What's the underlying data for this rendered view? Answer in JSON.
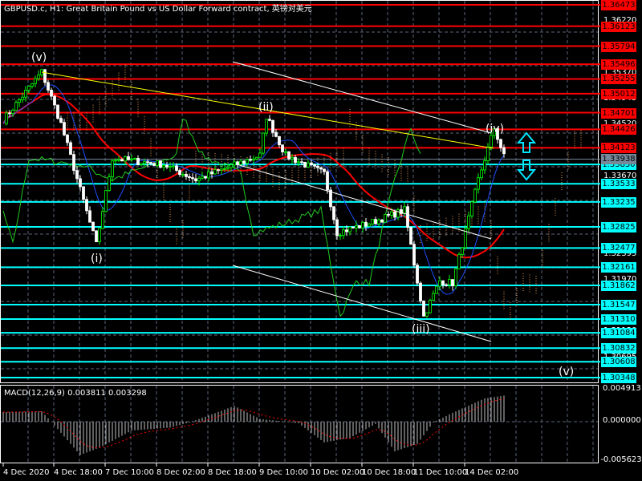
{
  "header": {
    "title": "GBPUSD.c, H1:  Great Britain Pound vs US Dollar Forward contract, 英镑对美元"
  },
  "macd": {
    "title": "MACD(12,26,9) 0.003811 0.003298",
    "max_label": "0.004913",
    "zero_label": "0.000000",
    "min_label": "-0.005623",
    "max": 0.004913,
    "min": -0.005623
  },
  "price_scale": {
    "top": 1.36473,
    "bottom": 1.30348
  },
  "resistance_levels": [
    "1.36473",
    "1.36123",
    "1.35794",
    "1.35496",
    "1.35255",
    "1.35012",
    "1.34701",
    "1.34426",
    "1.34123"
  ],
  "support_levels": [
    "1.33850",
    "1.33533",
    "1.33235",
    "1.32825",
    "1.32477",
    "1.32161",
    "1.31862",
    "1.31547",
    "1.31310",
    "1.31084",
    "1.30832",
    "1.30608",
    "1.30348"
  ],
  "current_price": "1.33938",
  "price_ticks": [
    "1.36220",
    "1.35370",
    "1.34945",
    "1.34520",
    "1.33670",
    "1.32395",
    "1.31970",
    "1.31130",
    "1.30695"
  ],
  "time_labels": [
    "4 Dec 2020",
    "4 Dec 18:00",
    "7 Dec 10:00",
    "8 Dec 02:00",
    "8 Dec 18:00",
    "9 Dec 10:00",
    "10 Dec 02:00",
    "10 Dec 18:00",
    "11 Dec 10:00",
    "14 Dec 02:00"
  ],
  "wave_labels": [
    "(v)",
    "(i)",
    "(ii)",
    "(iii)",
    "(iv)",
    "(v)"
  ],
  "colors": {
    "resistance": "#ff0000",
    "support": "#00ffff",
    "bull": "#00ff00",
    "bear": "#ffffff",
    "grid": "#5a6478"
  },
  "price_path": [
    [
      0,
      1.3458
    ],
    [
      12,
      1.3537
    ],
    [
      18,
      1.3452
    ],
    [
      29,
      1.3253
    ],
    [
      34,
      1.3395
    ],
    [
      50,
      1.3385
    ],
    [
      60,
      1.336
    ],
    [
      80,
      1.34
    ],
    [
      82,
      1.3464
    ],
    [
      88,
      1.34
    ],
    [
      100,
      1.337
    ],
    [
      104,
      1.3273
    ],
    [
      115,
      1.329
    ],
    [
      125,
      1.331
    ],
    [
      131,
      1.3135
    ],
    [
      136,
      1.3194
    ],
    [
      140,
      1.319
    ],
    [
      148,
      1.336
    ],
    [
      153,
      1.3445
    ],
    [
      156,
      1.3398
    ]
  ],
  "macd_path": [
    [
      0,
      0.0014
    ],
    [
      12,
      0.0015
    ],
    [
      15,
      0.0
    ],
    [
      24,
      -0.0045
    ],
    [
      30,
      -0.0035
    ],
    [
      40,
      -0.0012
    ],
    [
      52,
      -0.0008
    ],
    [
      58,
      -0.0001
    ],
    [
      64,
      0.0009
    ],
    [
      72,
      0.0023
    ],
    [
      80,
      0.0004
    ],
    [
      92,
      -0.0002
    ],
    [
      100,
      -0.0028
    ],
    [
      108,
      -0.0022
    ],
    [
      116,
      -0.0003
    ],
    [
      122,
      -0.004
    ],
    [
      129,
      -0.003
    ],
    [
      134,
      -0.0001
    ],
    [
      140,
      0.0013
    ],
    [
      150,
      0.0034
    ],
    [
      156,
      0.0038
    ]
  ]
}
